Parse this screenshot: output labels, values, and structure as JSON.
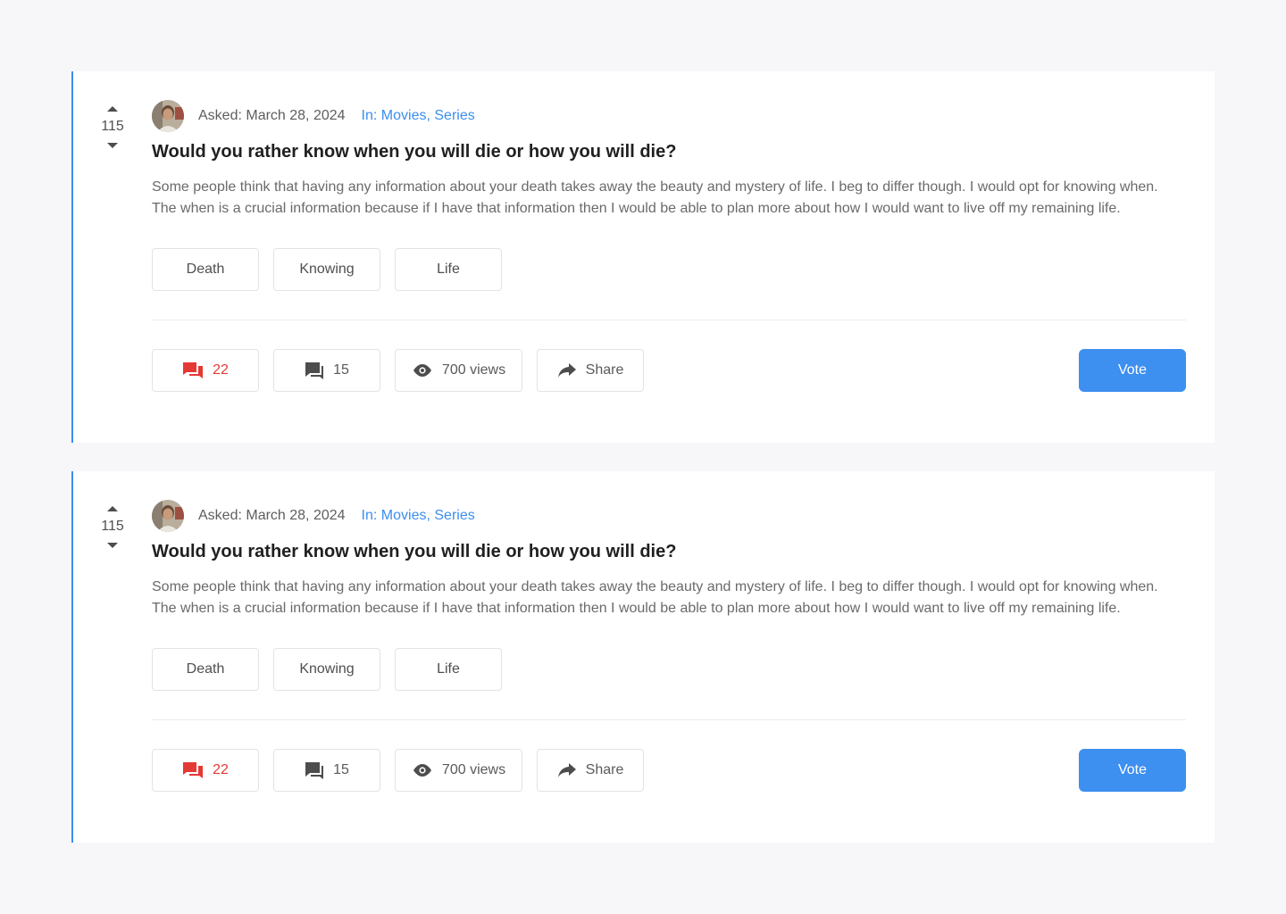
{
  "colors": {
    "accent": "#3a8ef0",
    "hot": "#e53935",
    "icon": "#4d4d4d"
  },
  "questions": [
    {
      "votes": "115",
      "asked": "Asked: March 28, 2024",
      "in_prefix": "In:",
      "categories": [
        "Movies",
        "Series"
      ],
      "title": "Would you rather know when you will die or how you will die?",
      "body": "Some people think that having any information about your death takes away the beauty and mystery of life. I beg to differ though. I would opt for knowing when. The when is a crucial information because if I have that information then I would be able to plan more about how I would want to live off my remaining life.",
      "tags": [
        "Death",
        "Knowing",
        "Life"
      ],
      "actions": {
        "answers": "22",
        "comments": "15",
        "views": "700 views",
        "share": "Share",
        "vote": "Vote"
      },
      "icons": {
        "answers": "chat-bubbles-icon",
        "comments": "comment-icon",
        "views": "eye-icon",
        "share": "share-arrow-icon"
      }
    },
    {
      "votes": "115",
      "asked": "Asked: March 28, 2024",
      "in_prefix": "In:",
      "categories": [
        "Movies",
        "Series"
      ],
      "title": "Would you rather know when you will die or how you will die?",
      "body": "Some people think that having any information about your death takes away the beauty and mystery of life. I beg to differ though. I would opt for knowing when. The when is a crucial information because if I have that information then I would be able to plan more about how I would want to live off my remaining life.",
      "tags": [
        "Death",
        "Knowing",
        "Life"
      ],
      "actions": {
        "answers": "22",
        "comments": "15",
        "views": "700 views",
        "share": "Share",
        "vote": "Vote"
      },
      "icons": {
        "answers": "chat-bubbles-icon",
        "comments": "comment-icon",
        "views": "eye-icon",
        "share": "share-arrow-icon"
      }
    }
  ]
}
